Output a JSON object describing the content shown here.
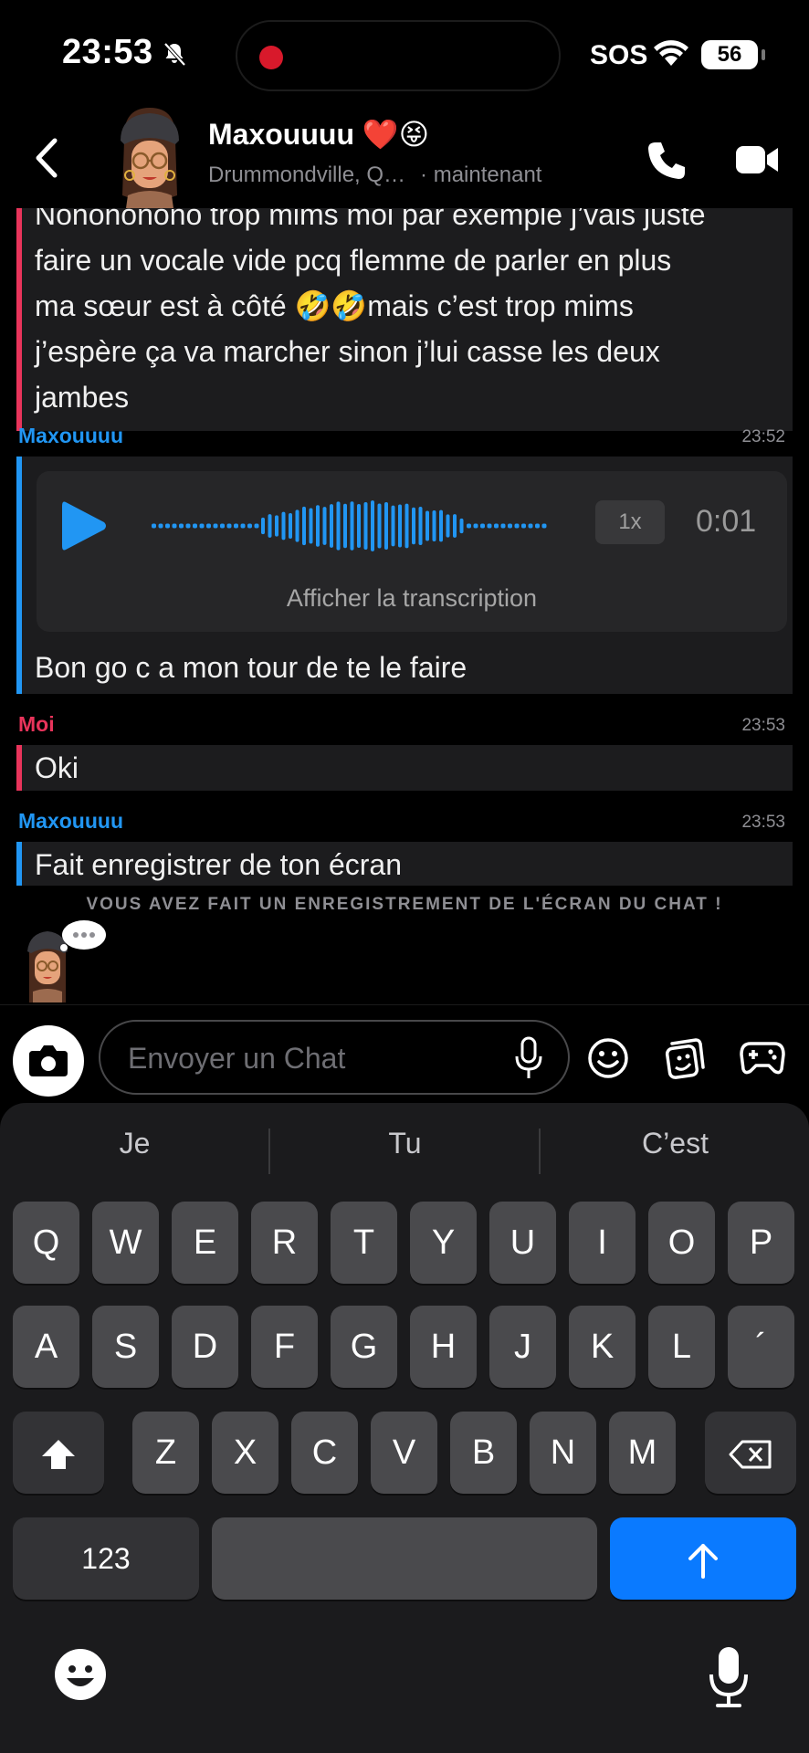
{
  "status_bar": {
    "time": "23:53",
    "sos": "SOS",
    "battery": "56"
  },
  "header": {
    "contact_name": "Maxouuuu ❤️😝",
    "location": "Drummondville, Q…",
    "presence": "· maintenant"
  },
  "messages": [
    {
      "kind": "text",
      "sender_color": "#e8345b",
      "text_lines": [
        "Nonononono trop mims moi par exemple j’vais juste",
        "faire un vocale vide pcq flemme de parler en plus",
        "ma sœur est à côté 🤣🤣mais c’est trop mims",
        "j’espère ça va marcher sinon j’lui casse les deux",
        "jambes"
      ]
    },
    {
      "kind": "voice",
      "sender": "Maxouuuu",
      "time": "23:52",
      "speed": "1x",
      "duration": "0:01",
      "transcript_label": "Afficher la transcription",
      "caption": "Bon go c a mon tour de te le faire"
    },
    {
      "kind": "text",
      "sender": "Moi",
      "time": "23:53",
      "text": "Oki"
    },
    {
      "kind": "text",
      "sender": "Maxouuuu",
      "time": "23:53",
      "text": "Fait enregistrer de ton écran"
    }
  ],
  "screen_notice": "VOUS AVEZ FAIT UN ENREGISTREMENT DE L'ÉCRAN DU CHAT !",
  "composer": {
    "placeholder": "Envoyer un Chat"
  },
  "keyboard": {
    "suggestions": [
      "Je",
      "Tu",
      "C’est"
    ],
    "row1": [
      "Q",
      "W",
      "E",
      "R",
      "T",
      "Y",
      "U",
      "I",
      "O",
      "P"
    ],
    "row2": [
      "A",
      "S",
      "D",
      "F",
      "G",
      "H",
      "J",
      "K",
      "L",
      "´"
    ],
    "row3": [
      "Z",
      "X",
      "C",
      "V",
      "B",
      "N",
      "M"
    ],
    "numbers_label": "123"
  },
  "colors": {
    "accent_blue": "#2196f3",
    "accent_red": "#e8345b",
    "send_key": "#0a7aff",
    "record_dot": "#d8192b"
  },
  "icons": {
    "back": "chevron-left-icon",
    "call": "phone-icon",
    "video": "video-camera-icon",
    "play": "play-icon",
    "camera": "camera-icon",
    "mic": "microphone-icon",
    "emoji": "smiley-icon",
    "sticker": "sticker-icon",
    "games": "gamepad-icon",
    "shift": "shift-icon",
    "delete": "backspace-icon",
    "send": "arrow-up-icon"
  }
}
